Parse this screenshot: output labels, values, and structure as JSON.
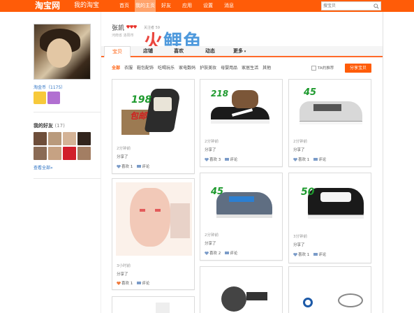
{
  "topbar": {
    "logo": "淘宝网",
    "logo_sub": "我的淘宝",
    "nav": [
      "首页",
      "我的主页",
      "好友",
      "应用",
      "设置",
      "消息"
    ],
    "search_placeholder": "搜宝贝",
    "accent": "#ff5c08"
  },
  "profile": {
    "name": "张凯",
    "meta": "关注者 59",
    "location": "河南省 洛阳市",
    "coins": "淘金币（1175）",
    "friends_title": "我的好友",
    "friends_count": "(17)",
    "see_all": "查看全部»"
  },
  "watermark": {
    "part1": "火",
    "part2": "鲤鱼"
  },
  "tabs": [
    "宝贝",
    "店铺",
    "喜欢",
    "动态",
    "更多"
  ],
  "categories": [
    "全部",
    "衣服",
    "鞋包配饰",
    "吃喝玩乐",
    "家电数码",
    "护肤美妆",
    "母婴用品",
    "家居生活",
    "其他"
  ],
  "recommend_label": "TA的推荐",
  "share_button": "分享宝贝",
  "cards": [
    {
      "time": "2分钟前",
      "share": "分享了",
      "likes": "喜欢 1",
      "comment": "评论",
      "promo_price": "198",
      "promo_text": "包邮"
    },
    {
      "time": "2分钟前",
      "share": "分享了",
      "likes": "喜欢 3",
      "comment": "评论",
      "promo_price": "218",
      "promo_text": ""
    },
    {
      "time": "2分钟前",
      "share": "分享了",
      "likes": "喜欢 1",
      "comment": "评论",
      "promo_price": "45",
      "promo_text": ""
    },
    {
      "time": "3小时前",
      "share": "分享了",
      "likes": "喜欢 1",
      "comment": "评论",
      "promo_price": "",
      "promo_text": ""
    },
    {
      "time": "2分钟前",
      "share": "分享了",
      "likes": "喜欢 2",
      "comment": "评论",
      "promo_price": "45",
      "promo_text": ""
    },
    {
      "time": "3分钟前",
      "share": "分享了",
      "likes": "喜欢 1",
      "comment": "评论",
      "promo_price": "50",
      "promo_text": ""
    }
  ]
}
